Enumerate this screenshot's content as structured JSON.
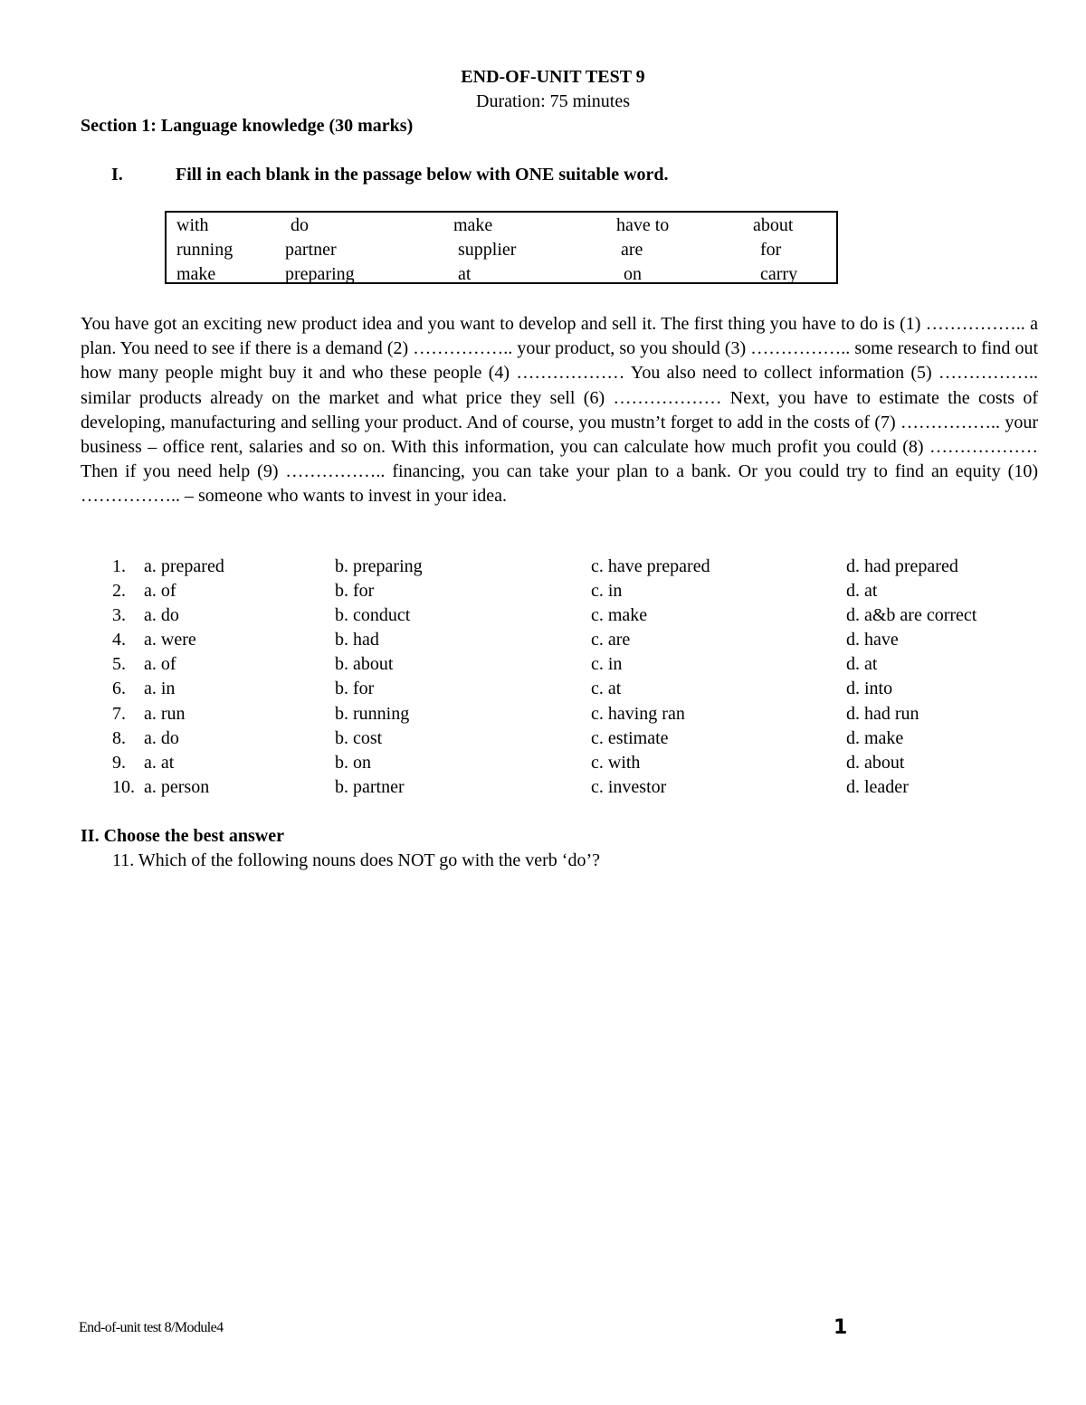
{
  "header": {
    "title": "END-OF-UNIT TEST 9",
    "duration": "Duration: 75 minutes"
  },
  "section1": {
    "heading": "Section 1: Language knowledge (30 marks)",
    "part1": {
      "roman": "I.",
      "instruction": "Fill in each blank in the passage below with ONE suitable word."
    },
    "word_box": {
      "rows": [
        [
          "with",
          "do",
          "make",
          "have to",
          "about"
        ],
        [
          "running",
          "partner",
          "supplier",
          "are",
          "for"
        ],
        [
          "make",
          "preparing",
          "at",
          "on",
          "carry"
        ]
      ]
    },
    "passage": "You have got an exciting new product idea and you want to develop and sell it. The first thing you have to do is (1) …………….. a plan. You need to see if there is a demand (2) …………….. your product, so you should (3) …………….. some research to find out how many people might buy it and who these people (4) ……………… You also need to collect information (5) …………….. similar products already on the market and what price they sell (6) ……………… Next, you have to estimate the costs of developing, manufacturing and selling your product. And of course, you mustn’t forget to add in the costs of (7) …………….. your business – office rent, salaries and so on. With this information, you can calculate how much profit you could (8) ……………… Then if you need help  (9) …………….. financing, you can take your plan to a bank. Or you could try to find an equity (10) …………….. – someone who wants to invest in your idea.",
    "questions": [
      {
        "num": "1.",
        "a": "a. prepared",
        "b": "b. preparing",
        "c": "c. have prepared",
        "d": "d. had prepared"
      },
      {
        "num": "2.",
        "a": "a. of",
        "b": "b. for",
        "c": "c. in",
        "d": "d. at"
      },
      {
        "num": "3.",
        "a": "a. do",
        "b": "b. conduct",
        "c": "c. make",
        "d": "d. a&b are correct"
      },
      {
        "num": "4.",
        "a": "a. were",
        "b": "b. had",
        "c": "c. are",
        "d": "d. have"
      },
      {
        "num": "5.",
        "a": "a. of",
        "b": "b. about",
        "c": "c. in",
        "d": "d. at"
      },
      {
        "num": "6.",
        "a": "a. in",
        "b": "b. for",
        "c": "c. at",
        "d": "d. into"
      },
      {
        "num": "7.",
        "a": "a. run",
        "b": "b. running",
        "c": "c. having ran",
        "d": "d. had run"
      },
      {
        "num": "8.",
        "a": "a. do",
        "b": "b. cost",
        "c": "c. estimate",
        "d": "d. make"
      },
      {
        "num": "9.",
        "a": "a. at",
        "b": "b. on",
        "c": "c. with",
        "d": "d. about"
      },
      {
        "num": "10.",
        "a": "a. person",
        "b": "b. partner",
        "c": "c. investor",
        "d": "d. leader"
      }
    ],
    "part2": {
      "heading": "II. Choose the best answer",
      "question_11": "11. Which of the following nouns does NOT go with the verb ‘do’?"
    }
  },
  "footer": {
    "text": "End-of-unit test 8/Module4",
    "page_number": "1"
  }
}
